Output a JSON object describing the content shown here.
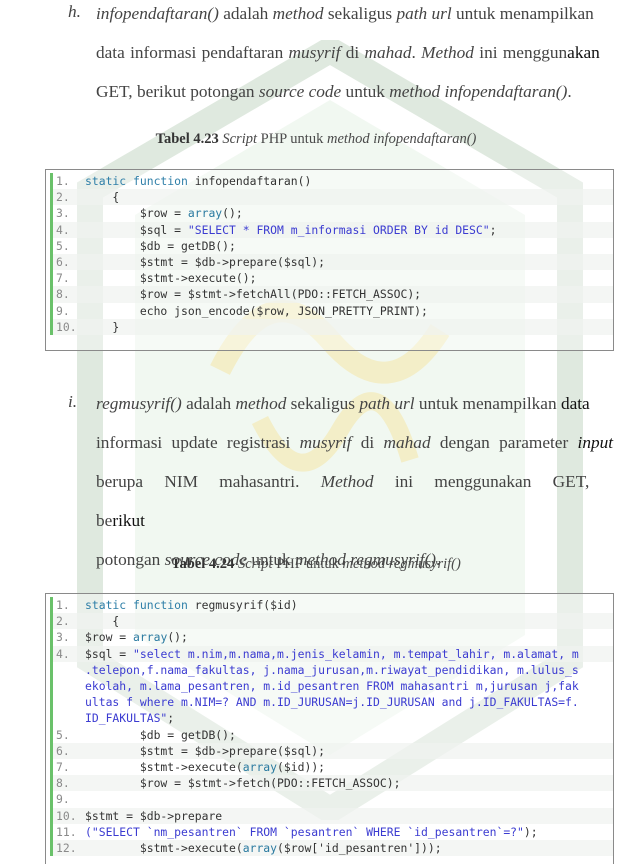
{
  "section_h": {
    "marker": "h.",
    "line1": {
      "fn": "infopendaftaran()",
      "t1": " adalah ",
      "m1": "method",
      "t2": " sekaligus ",
      "m2": "path url",
      "t3": " untuk menampilkan"
    },
    "line2": {
      "t1": "data informasi pendaftaran ",
      "m1": "musyrif",
      "t2": " di ",
      "m2": "mahad",
      "t3": ". ",
      "m3": "Method",
      "t4": " ini menggun",
      "t5": "akan"
    },
    "line3": {
      "t1": "GET, berikut potongan ",
      "m1": "source code",
      "t2": " untuk ",
      "m2": "method infopendaftaran()",
      "t3": "."
    }
  },
  "caption_23": {
    "bold": "Tabel 4.23",
    "i1": " Script",
    "t1": " PHP untuk ",
    "i2": "method infopendaftaran()"
  },
  "code_23": [
    {
      "n": "1.",
      "parts": [
        [
          "kw",
          "static function"
        ],
        [
          "",
          " infopendaftaran()"
        ]
      ]
    },
    {
      "n": "2.",
      "parts": [
        [
          "",
          "    {"
        ]
      ]
    },
    {
      "n": "3.",
      "parts": [
        [
          "",
          "        $row = "
        ],
        [
          "fn",
          "array"
        ],
        [
          "",
          "();"
        ]
      ]
    },
    {
      "n": "4.",
      "parts": [
        [
          "",
          "        $sql = "
        ],
        [
          "str",
          "\"SELECT * FROM m_informasi ORDER BY id DESC\""
        ],
        [
          "",
          ";"
        ]
      ]
    },
    {
      "n": "5.",
      "parts": [
        [
          "",
          "        $db = getDB();"
        ]
      ]
    },
    {
      "n": "6.",
      "parts": [
        [
          "",
          "        $stmt = $db->prepare($sql);"
        ]
      ]
    },
    {
      "n": "7.",
      "parts": [
        [
          "",
          "        $stmt->execute();"
        ]
      ]
    },
    {
      "n": "8.",
      "parts": [
        [
          "",
          "        $row = $stmt->fetchAll(PDO::FETCH_ASSOC);"
        ]
      ]
    },
    {
      "n": "9.",
      "parts": [
        [
          "",
          "        echo json_encode($row, JSON_PRETTY_PRINT);"
        ]
      ]
    },
    {
      "n": "10.",
      "parts": [
        [
          "",
          "    }"
        ]
      ]
    }
  ],
  "section_i": {
    "marker": "i.",
    "line1": {
      "fn": "regmusyrif()",
      "t1": " adalah ",
      "m1": "method",
      "t2": " sekaligus ",
      "m2": "path url",
      "t3": " untuk menampilkan ",
      "t4": "data"
    },
    "line2": {
      "t1": "informasi update registrasi ",
      "m1": "musyrif",
      "t2": " di ",
      "m2": "mahad",
      "t3": " dengan parameter ",
      "m3": "input"
    },
    "line3": {
      "t1": "berupa NIM mahasantri. ",
      "m1": "Method",
      "t2": " ini menggunakan GET, be",
      "t3": "rikut"
    },
    "line4": {
      "t1": "potongan ",
      "m1": "source code",
      "t2": " untuk ",
      "m2": "method regmusyrif()",
      "t3": "."
    }
  },
  "caption_24": {
    "bold": "Tabel 4.24",
    "i1": " Script",
    "t1": " PHP untuk ",
    "i2": "method regmusyrif()"
  },
  "code_24": [
    {
      "n": "1.",
      "parts": [
        [
          "kw",
          "static function"
        ],
        [
          "",
          " regmusyrif($id)"
        ]
      ]
    },
    {
      "n": "2.",
      "parts": [
        [
          "",
          "    {"
        ]
      ]
    },
    {
      "n": "3.",
      "parts": [
        [
          "",
          "$row = "
        ],
        [
          "fn",
          "array"
        ],
        [
          "",
          "();"
        ]
      ]
    },
    {
      "n": "4.",
      "parts": [
        [
          "",
          "$sql = "
        ],
        [
          "str",
          "\"select m.nim,m.nama,m.jenis_kelamin, m.tempat_lahir, m.alamat, m"
        ]
      ],
      "wrap": [
        [
          [
            "str",
            ".telepon,f.nama_fakultas, j.nama_jurusan,m.riwayat_pendidikan, m.lulus_s"
          ]
        ],
        [
          [
            "str",
            "ekolah, m.lama_pesantren, m.id_pesantren FROM mahasantri m,jurusan j,fak"
          ]
        ],
        [
          [
            "str",
            "ultas f where m.NIM=? AND m.ID_JURUSAN=j.ID_JURUSAN and j.ID_FAKULTAS=f."
          ]
        ],
        [
          [
            "str",
            "ID_FAKULTAS\""
          ],
          [
            "",
            ";"
          ]
        ]
      ]
    },
    {
      "n": "5.",
      "parts": [
        [
          "",
          "        $db = getDB();"
        ]
      ]
    },
    {
      "n": "6.",
      "parts": [
        [
          "",
          "        $stmt = $db->prepare($sql);"
        ]
      ]
    },
    {
      "n": "7.",
      "parts": [
        [
          "",
          "        $stmt->execute("
        ],
        [
          "fn",
          "array"
        ],
        [
          "",
          "($id));"
        ]
      ]
    },
    {
      "n": "8.",
      "parts": [
        [
          "",
          "        $row = $stmt->fetch(PDO::FETCH_ASSOC);"
        ]
      ]
    },
    {
      "n": "9.",
      "parts": [
        [
          "",
          ""
        ]
      ]
    },
    {
      "n": "10.",
      "parts": [
        [
          "",
          "$stmt = $db->prepare"
        ]
      ]
    },
    {
      "n": "11.",
      "parts": [
        [
          "str",
          "(\"SELECT `nm_pesantren` FROM `pesantren` WHERE `id_pesantren`=?\""
        ],
        [
          "",
          ");"
        ]
      ]
    },
    {
      "n": "12.",
      "parts": [
        [
          "",
          "        $stmt->execute("
        ],
        [
          "fn",
          "array"
        ],
        [
          "",
          "($row['id_pesantren']));"
        ]
      ]
    }
  ]
}
